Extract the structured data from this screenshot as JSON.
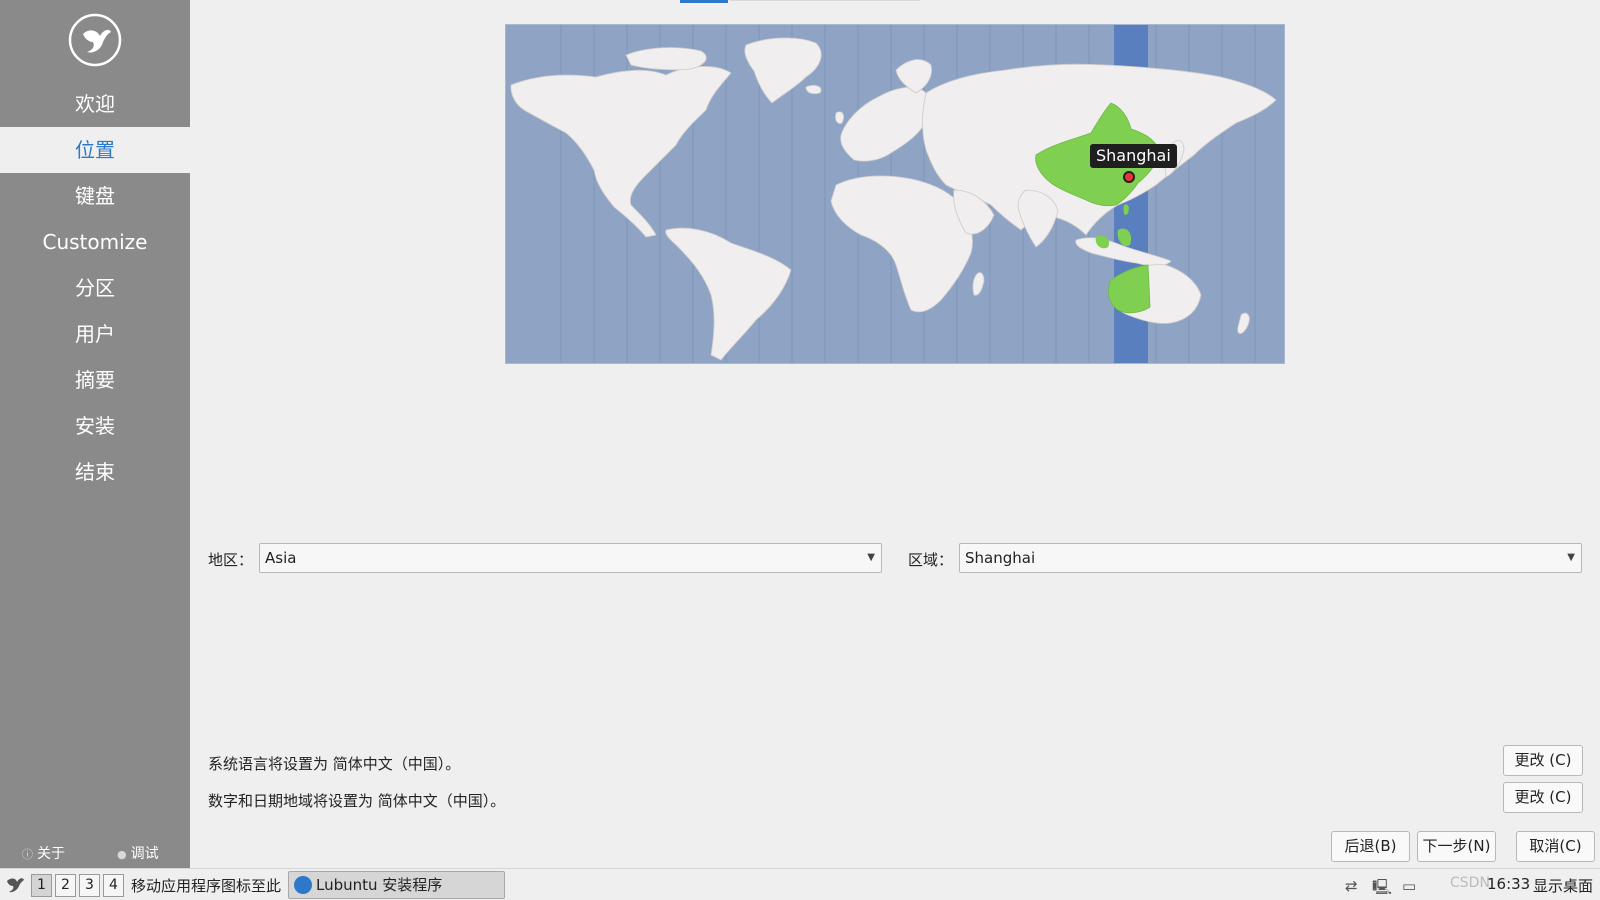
{
  "sidebar": {
    "items": [
      {
        "label": "欢迎"
      },
      {
        "label": "位置"
      },
      {
        "label": "键盘"
      },
      {
        "label": "Customize"
      },
      {
        "label": "分区"
      },
      {
        "label": "用户"
      },
      {
        "label": "摘要"
      },
      {
        "label": "安装"
      },
      {
        "label": "结束"
      }
    ],
    "about": "关于",
    "debug": "调试"
  },
  "map": {
    "tooltip": "Shanghai"
  },
  "location": {
    "region_label": "地区：",
    "region_value": "Asia",
    "zone_label": "区域：",
    "zone_value": "Shanghai"
  },
  "info": {
    "language_text": "系统语言将设置为 简体中文（中国）。",
    "locale_text": "数字和日期地域将设置为 简体中文（中国）。",
    "change_label": "更改 (C)"
  },
  "footer_buttons": {
    "back": "后退(B)",
    "next": "下一步(N)",
    "cancel": "取消(C)"
  },
  "taskbar": {
    "workspaces": [
      "1",
      "2",
      "3",
      "4"
    ],
    "hint": "移动应用程序图标至此",
    "task_label": "Lubuntu 安装程序",
    "clock": "16:33",
    "show_desktop": "显示桌面",
    "watermark": "CSDN"
  },
  "colors": {
    "accent": "#2d78c8",
    "sidebar_bg": "#8a8a8a",
    "map_ocean": "#8fa4c4",
    "map_land": "#f0eeee",
    "map_highlight": "#7fcf50",
    "timezone_band": "#5a7fbf"
  }
}
